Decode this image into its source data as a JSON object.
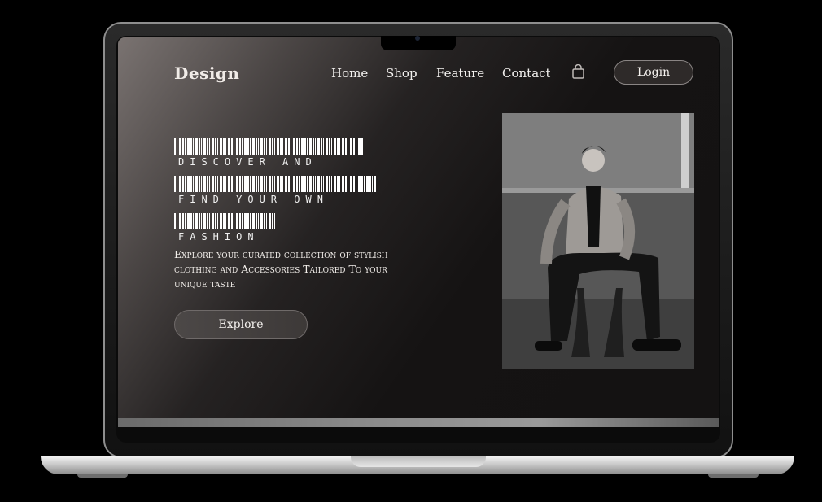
{
  "header": {
    "logo": "Design",
    "nav": [
      "Home",
      "Shop",
      "Feature",
      "Contact"
    ],
    "login_label": "Login"
  },
  "hero": {
    "lines": [
      "DISCOVER AND",
      "FIND YOUR OWN",
      "FASHION"
    ],
    "description": "Explore your curated collection of stylish clothing and Accessories Tailored To your unique taste",
    "button_label": "Explore"
  },
  "icons": [
    "shopping-bag-icon",
    "camera-icon"
  ],
  "colors": {
    "screen_dark": "#141212",
    "text": "#f2f0ee",
    "button": "#3d3938"
  }
}
